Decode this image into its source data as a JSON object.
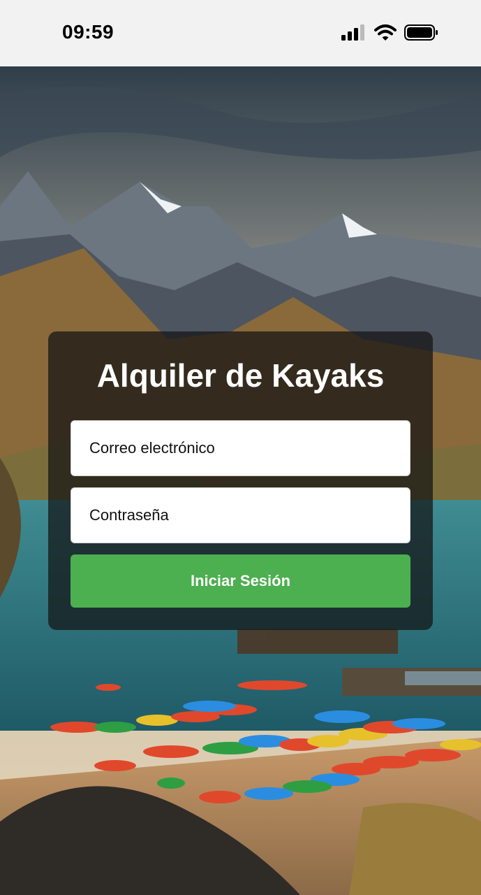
{
  "status_bar": {
    "time": "09:59",
    "icons": [
      "signal-icon",
      "wifi-icon",
      "battery-icon"
    ]
  },
  "background": {
    "icon": "mountain-lake-kayaks-image"
  },
  "login": {
    "title": "Alquiler de Kayaks",
    "email_placeholder": "Correo electrónico",
    "password_placeholder": "Contraseña",
    "submit_label": "Iniciar Sesión",
    "button_color": "#4caf50"
  }
}
